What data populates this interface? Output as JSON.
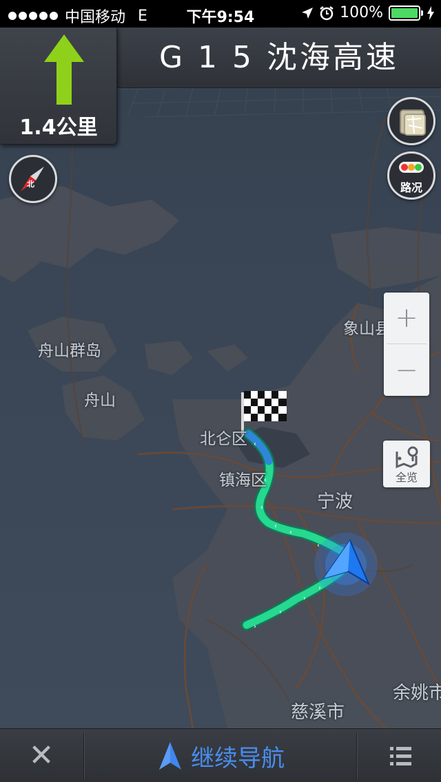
{
  "status_bar": {
    "carrier": "中国移动",
    "network": "E",
    "time": "下午9:54",
    "battery": "100%",
    "signal_dots": 5,
    "icons": [
      "location-arrow-icon",
      "alarm-icon",
      "battery-icon",
      "charging-icon"
    ]
  },
  "guidance": {
    "road_name": "G 1 5 沈海高速",
    "distance": "1.4公里",
    "maneuver": "straight-arrow-icon"
  },
  "map": {
    "labels": [
      "舟山群岛",
      "舟山",
      "北仑区",
      "镇海区",
      "宁波",
      "象山县",
      "余姚市",
      "慈溪市"
    ]
  },
  "controls": {
    "compass": "compass-icon",
    "layers": "map-layers-icon",
    "traffic_label": "路况",
    "zoom_in": "+",
    "zoom_out": "−",
    "overview_label": "全览"
  },
  "bottom_bar": {
    "close": "✕",
    "continue_label": "继续导航",
    "menu": "list-icon"
  },
  "colors": {
    "route_green": "#23d48a",
    "route_blue": "#3c9bf0",
    "accent_blue": "#4a8df0",
    "arrow_green": "#8fd11a"
  }
}
